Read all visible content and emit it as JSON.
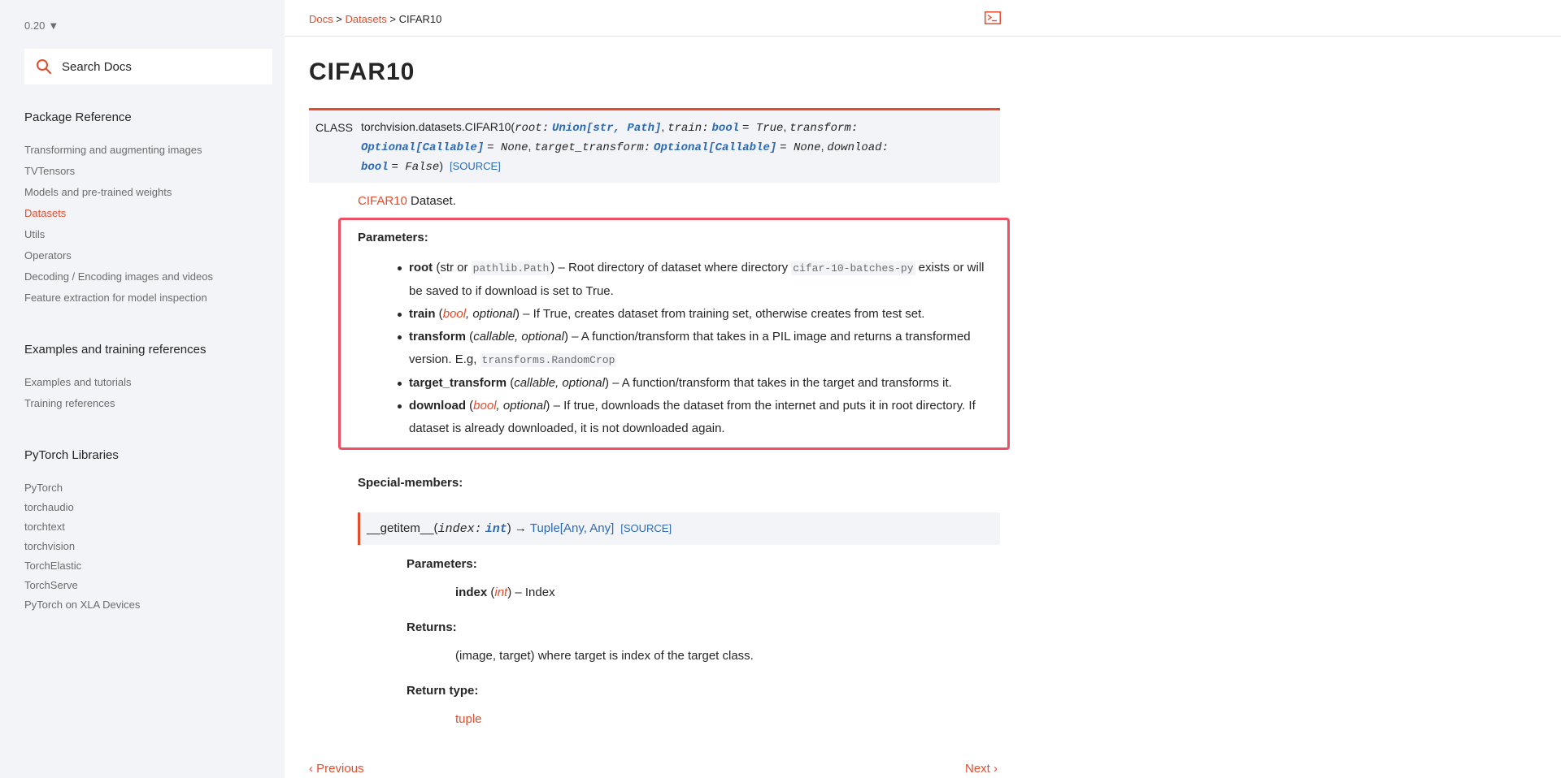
{
  "sidebar": {
    "version": "0.20",
    "search_placeholder": "Search Docs",
    "sections": [
      {
        "title": "Package Reference",
        "items": [
          {
            "label": "Transforming and augmenting images"
          },
          {
            "label": "TVTensors"
          },
          {
            "label": "Models and pre-trained weights"
          },
          {
            "label": "Datasets",
            "active": true
          },
          {
            "label": "Utils"
          },
          {
            "label": "Operators"
          },
          {
            "label": "Decoding / Encoding images and videos"
          },
          {
            "label": "Feature extraction for model inspection"
          }
        ]
      },
      {
        "title": "Examples and training references",
        "items": [
          {
            "label": "Examples and tutorials"
          },
          {
            "label": "Training references"
          }
        ]
      },
      {
        "title": "PyTorch Libraries",
        "items": [
          {
            "label": "PyTorch"
          },
          {
            "label": "torchaudio"
          },
          {
            "label": "torchtext"
          },
          {
            "label": "torchvision"
          },
          {
            "label": "TorchElastic"
          },
          {
            "label": "TorchServe"
          },
          {
            "label": "PyTorch on XLA Devices"
          }
        ]
      }
    ]
  },
  "breadcrumb": {
    "docs": "Docs",
    "sep1": " > ",
    "datasets": "Datasets",
    "sep2": " > ",
    "current": "CIFAR10"
  },
  "page": {
    "title": "CIFAR10",
    "signature": {
      "class_label": "CLASS",
      "name": "torchvision.datasets.CIFAR10(",
      "root_arg": "root:",
      "root_type": "Union[str, Path]",
      "train_arg": "train:",
      "train_type": "bool",
      "train_default": "= True",
      "transform_arg": "transform:",
      "transform_type": "Optional[Callable]",
      "transform_default": "= None",
      "target_transform_arg": "target_transform:",
      "target_transform_type": "Optional[Callable]",
      "target_transform_default": "= None",
      "download_arg": "download:",
      "download_type": "bool",
      "download_default": "= False",
      "close": ")",
      "source": "[SOURCE]"
    },
    "description": {
      "link": "CIFAR10",
      "text": " Dataset."
    },
    "parameters_label": "Parameters:",
    "parameters": {
      "root": {
        "name": "root",
        "t1": " (str or ",
        "code1": "pathlib.Path",
        "t2": ") – Root directory of dataset where directory ",
        "code2": "cifar-10-batches-py",
        "t3": " exists or will be saved to if download is set to True."
      },
      "train": {
        "name": "train",
        "t1": " (",
        "type": "bool",
        "t2": ", ",
        "opt": "optional",
        "t3": ") – If True, creates dataset from training set, otherwise creates from test set."
      },
      "transform": {
        "name": "transform",
        "t1": " (",
        "type": "callable, optional",
        "t2": ") – A function/transform that takes in a PIL image and returns a transformed version. E.g, ",
        "code": "transforms.RandomCrop"
      },
      "target_transform": {
        "name": "target_transform",
        "t1": " (",
        "type": "callable, optional",
        "t2": ") – A function/transform that takes in the target and transforms it."
      },
      "download": {
        "name": "download",
        "t1": " (",
        "type": "bool",
        "t2": ", ",
        "opt": "optional",
        "t3": ") – If true, downloads the dataset from the internet and puts it in root directory. If dataset is already downloaded, it is not downloaded again."
      }
    },
    "special_members_label": "Special-members:",
    "getitem": {
      "name": "__getitem__(",
      "arg": "index:",
      "arg_type": "int",
      "close": ")",
      "arrow": " → ",
      "ret": "Tuple[Any, Any]",
      "source": "[SOURCE]",
      "parameters_label": "Parameters:",
      "param_name": "index",
      "param_t1": " (",
      "param_type": "int",
      "param_t2": ") – Index",
      "returns_label": "Returns:",
      "returns": "(image, target) where target is index of the target class.",
      "return_type_label": "Return type:",
      "return_type": "tuple"
    },
    "pager": {
      "previous": "Previous",
      "next": "Next"
    }
  },
  "colors": {
    "accent": "#e44c2c",
    "highlight_box": "#ef4f62",
    "link_blue": "#2c6ab6",
    "sidebar_bg": "#f3f4f7"
  },
  "icons": {
    "search": "search-icon",
    "terminal": "terminal-icon"
  }
}
